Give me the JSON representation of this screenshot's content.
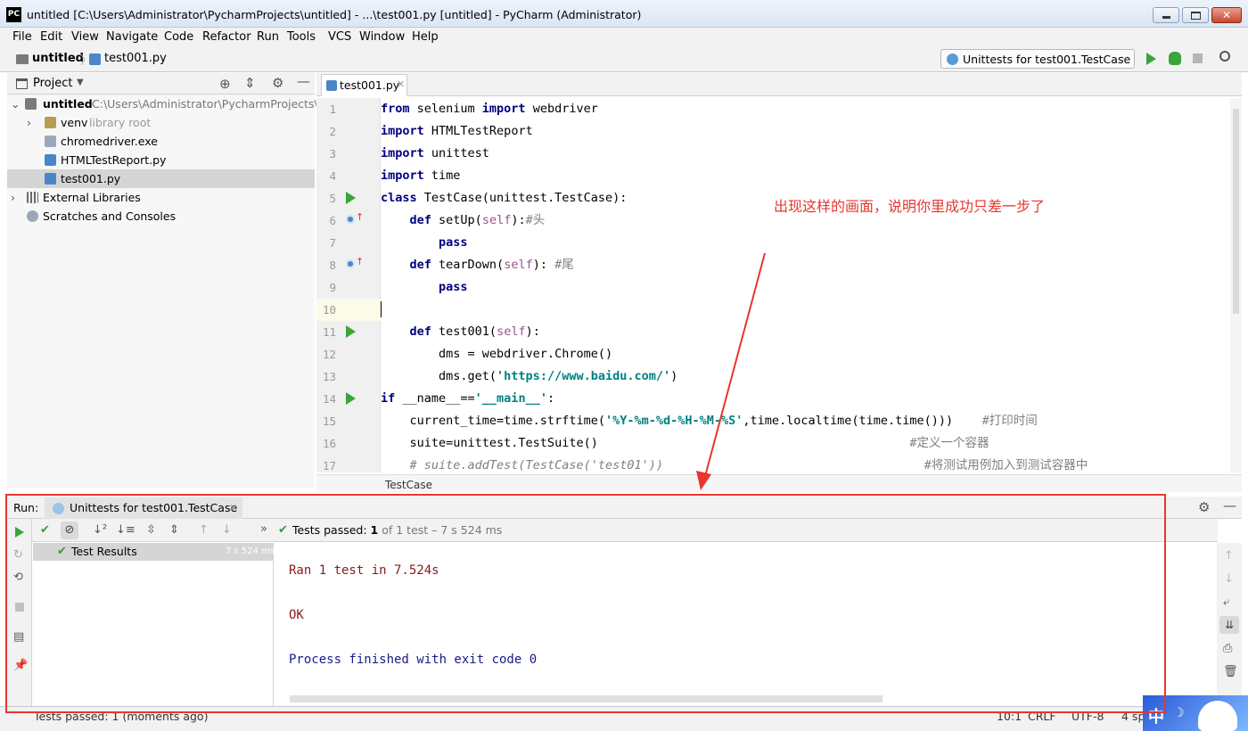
{
  "window": {
    "title": "untitled [C:\\Users\\Administrator\\PycharmProjects\\untitled] - ...\\test001.py [untitled] - PyCharm (Administrator)",
    "app_icon": "PC"
  },
  "menu": [
    "File",
    "Edit",
    "View",
    "Navigate",
    "Code",
    "Refactor",
    "Run",
    "Tools",
    "VCS",
    "Window",
    "Help"
  ],
  "nav": {
    "crumbs": [
      "untitled",
      "test001.py"
    ],
    "run_config": "Unittests for test001.TestCase"
  },
  "project": {
    "header": "Project",
    "tree": [
      {
        "label": "untitled",
        "extra": "C:\\Users\\Administrator\\PycharmProjects\\untitled",
        "icon": "folder-icon"
      },
      {
        "label": "venv",
        "extra": "library root",
        "icon": "folder-icon"
      },
      {
        "label": "chromedriver.exe",
        "icon": "file-icon"
      },
      {
        "label": "HTMLTestReport.py",
        "icon": "python-file-icon"
      },
      {
        "label": "test001.py",
        "icon": "python-file-icon",
        "selected": true
      },
      {
        "label": "External Libraries",
        "icon": "library-icon"
      },
      {
        "label": "Scratches and Consoles",
        "icon": "scratch-icon"
      }
    ]
  },
  "editor": {
    "tab": "test001.py",
    "line_numbers": [
      "1",
      "2",
      "3",
      "4",
      "5",
      "6",
      "7",
      "8",
      "9",
      "10",
      "11",
      "12",
      "13",
      "14",
      "15",
      "16",
      "17"
    ],
    "current_line": "10",
    "run_markers_on_lines": [
      "5",
      "11",
      "14"
    ],
    "override_markers_on_lines": [
      "6",
      "8"
    ],
    "breadcrumb": "TestCase"
  },
  "annotation": "出现这样的画面，说明你里成功只差一步了",
  "run": {
    "label": "Run:",
    "tab": "Unittests for test001.TestCase",
    "status_prefix": "Tests passed:",
    "status_count": "1",
    "status_detail": "of 1 test – 7 s 524 ms",
    "tree_root": "Test Results",
    "tree_time": "7 s 524 ms",
    "console": [
      {
        "text": "Ran 1 test in 7.524s",
        "color": "#8b1a1a"
      },
      {
        "text": "",
        "color": "#8b1a1a"
      },
      {
        "text": "OK",
        "color": "#8b1a1a"
      },
      {
        "text": "",
        "color": "#8b1a1a"
      },
      {
        "text": "Process finished with exit code 0",
        "color": "#1a1a8b"
      }
    ]
  },
  "status": {
    "message": "Tests passed: 1 (moments ago)",
    "position": "10:1",
    "line_sep": "CRLF",
    "encoding": "UTF-8",
    "indent": "4 sp",
    "ime": "中"
  },
  "colors": {
    "annotation": "#e8352f",
    "keyword": "#000080",
    "string": "#008080",
    "run_green": "#3aa53a"
  }
}
